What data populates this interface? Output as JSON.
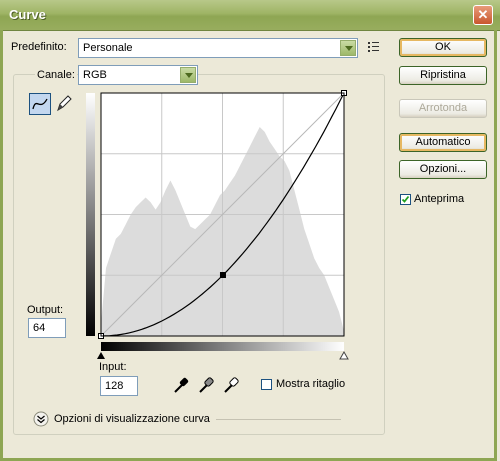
{
  "window": {
    "title": "Curve",
    "close_glyph": "✕"
  },
  "preset": {
    "label": "Predefinito:",
    "value": "Personale"
  },
  "channel": {
    "label": "Canale:",
    "value": "RGB"
  },
  "buttons": {
    "ok": "OK",
    "reset": "Ripristina",
    "smooth": "Arrotonda",
    "auto": "Automatico",
    "options": "Opzioni..."
  },
  "preview": {
    "label": "Anteprima",
    "checked": true
  },
  "output": {
    "label": "Output:",
    "value": "64"
  },
  "input": {
    "label": "Input:",
    "value": "128"
  },
  "show_clipping": {
    "label": "Mostra ritaglio",
    "checked": false
  },
  "curve_display_options": {
    "label": "Opzioni di visualizzazione curva"
  },
  "curve": {
    "points": [
      [
        0,
        0
      ],
      [
        128,
        64
      ],
      [
        255,
        255
      ]
    ],
    "selected_point": [
      128,
      64
    ]
  },
  "icons": {
    "curve_tool": "curve-tool-icon",
    "pencil_tool": "pencil-icon",
    "presets_menu": "preset-menu-icon",
    "black_point": "eyedropper-black-icon",
    "gray_point": "eyedropper-gray-icon",
    "white_point": "eyedropper-white-icon",
    "expand": "chevron-down-icon"
  }
}
